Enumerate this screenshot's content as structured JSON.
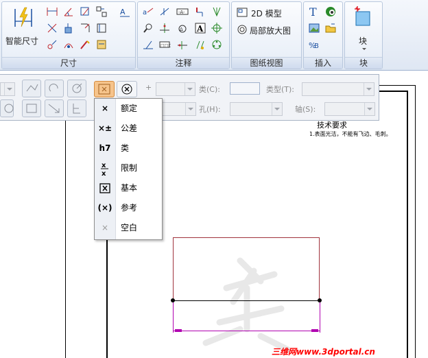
{
  "ribbon": {
    "smart_dim_label": "智能尺寸",
    "groups": {
      "dimension": "尺寸",
      "annotation": "注释",
      "drawing_view": "图纸视图",
      "insert": "插入",
      "block": "块"
    },
    "model_2d_label": "2D 模型",
    "detail_view_label": "局部放大图",
    "block_button_label": "块"
  },
  "propbar": {
    "plus_label": "+",
    "class_label": "类(C):",
    "type_label": "类型(T):",
    "hole_label": "孔(H):",
    "axis_label": "轴(S):"
  },
  "menu": {
    "items": [
      {
        "symbol": "×",
        "label": "额定"
      },
      {
        "symbol": "×±",
        "label": "公差"
      },
      {
        "symbol": "h7",
        "label": "类"
      },
      {
        "symbol": "x/x",
        "label": "限制"
      },
      {
        "symbol": "[×]",
        "label": "基本"
      },
      {
        "symbol": "(×)",
        "label": "参考"
      },
      {
        "symbol": "×",
        "label": "空白"
      }
    ]
  },
  "drawing": {
    "tech_req_title": "技术要求",
    "tech_req_item": "1.表面光洁，不能有飞边、毛刺。"
  },
  "watermark": "三维网www.3dportal.cn",
  "colors": {
    "rect_outline": "#a0323c",
    "dimension": "#b000b0",
    "highlight_button": "#f6c48c"
  }
}
